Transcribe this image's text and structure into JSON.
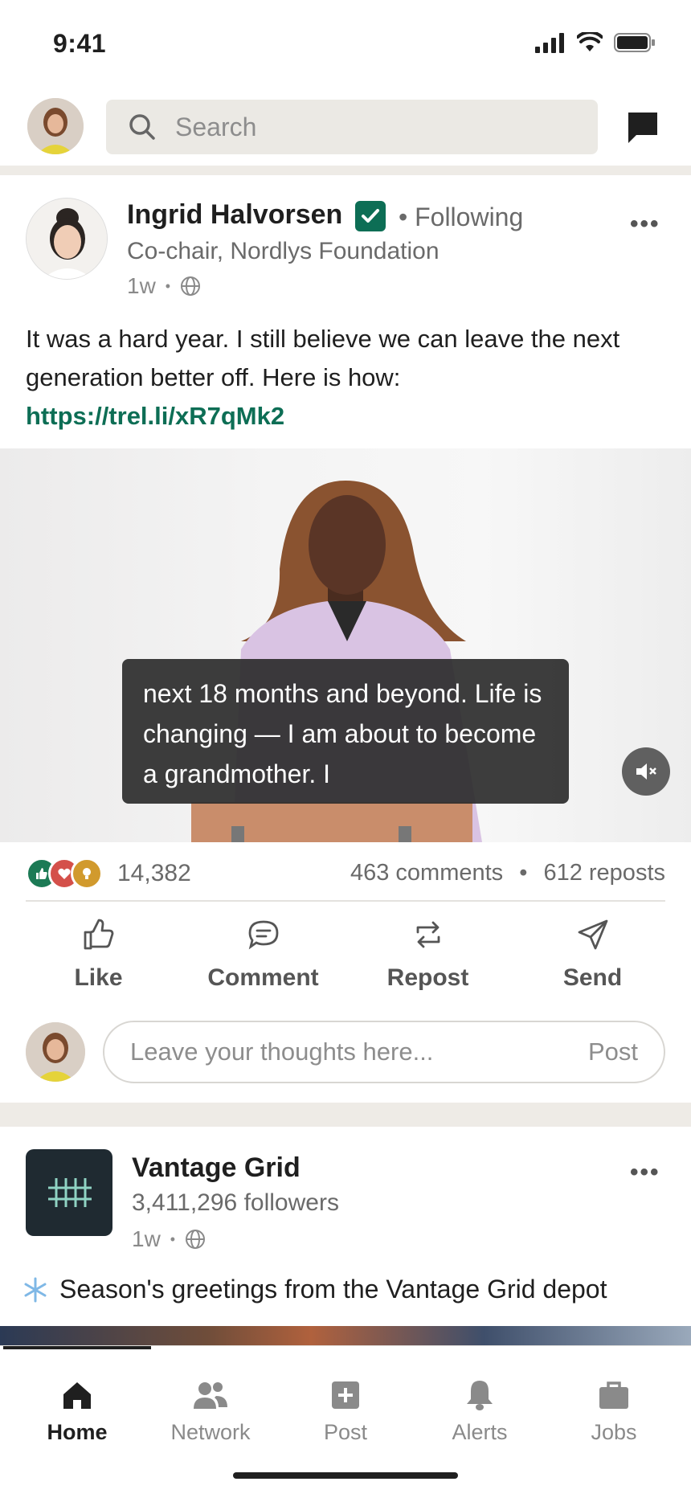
{
  "status": {
    "time": "9:41"
  },
  "search": {
    "placeholder": "Search"
  },
  "post1": {
    "author": "Ingrid Halvorsen",
    "follow_status": "• Following",
    "headline": "Co-chair, Nordlys Foundation",
    "age": "1w",
    "dot": "•",
    "text": "It was a hard year. I still believe we can leave the next generation better off. Here is how:",
    "link": "https://trel.li/xR7qMk2",
    "video_caption": "next 18 months and beyond. Life is changing — I am about to become a grandmother. I",
    "reactions_count": "14,382",
    "comments": "463 comments",
    "reposts": "612 reposts",
    "stats_dot": "•",
    "actions": {
      "like": "Like",
      "comment": "Comment",
      "repost": "Repost",
      "send": "Send"
    },
    "comment_placeholder": "Leave your thoughts here...",
    "comment_post": "Post",
    "colors": {
      "link": "#0d6e55",
      "verified": "#0d6e55"
    }
  },
  "post2": {
    "company": "Vantage Grid",
    "followers": "3,411,296 followers",
    "age": "1w",
    "dot": "•",
    "text": "Season's greetings from the Vantage Grid depot"
  },
  "nav": {
    "home": "Home",
    "network": "Network",
    "post": "Post",
    "alerts": "Alerts",
    "jobs": "Jobs"
  },
  "icons": [
    "signal-icon",
    "wifi-icon",
    "battery-icon",
    "search-icon",
    "message-icon",
    "verified-icon",
    "more-icon",
    "globe-icon",
    "mute-icon",
    "like-icon",
    "comment-icon",
    "repost-icon",
    "send-icon",
    "snowflake-icon",
    "home-icon",
    "network-icon",
    "post-icon",
    "alerts-icon",
    "jobs-icon"
  ]
}
